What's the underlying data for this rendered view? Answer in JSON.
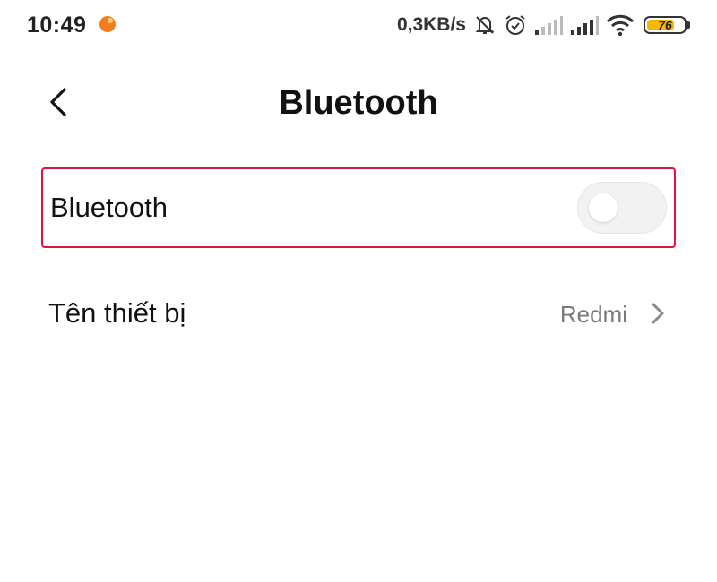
{
  "status_bar": {
    "time": "10:49",
    "net_speed": "0,3KB/s",
    "battery_level": "76",
    "battery_fraction": 0.76,
    "notification_icon": "orange-app-icon",
    "icons": [
      "mute-bell-icon",
      "alarm-clock-icon",
      "signal-weak-icon",
      "signal-icon",
      "wifi-icon",
      "battery-icon"
    ]
  },
  "header": {
    "back_icon": "chevron-left-icon",
    "title": "Bluetooth"
  },
  "settings": {
    "bluetooth": {
      "label": "Bluetooth",
      "enabled": false
    },
    "device_name": {
      "label": "Tên thiết bị",
      "value": "Redmi"
    }
  },
  "colors": {
    "highlight_border": "#e0143c",
    "battery_fill": "#f5b700",
    "notification": "#f57c1f",
    "toggle_off": "#f2f2f2",
    "secondary_text": "#7a7a7a"
  }
}
